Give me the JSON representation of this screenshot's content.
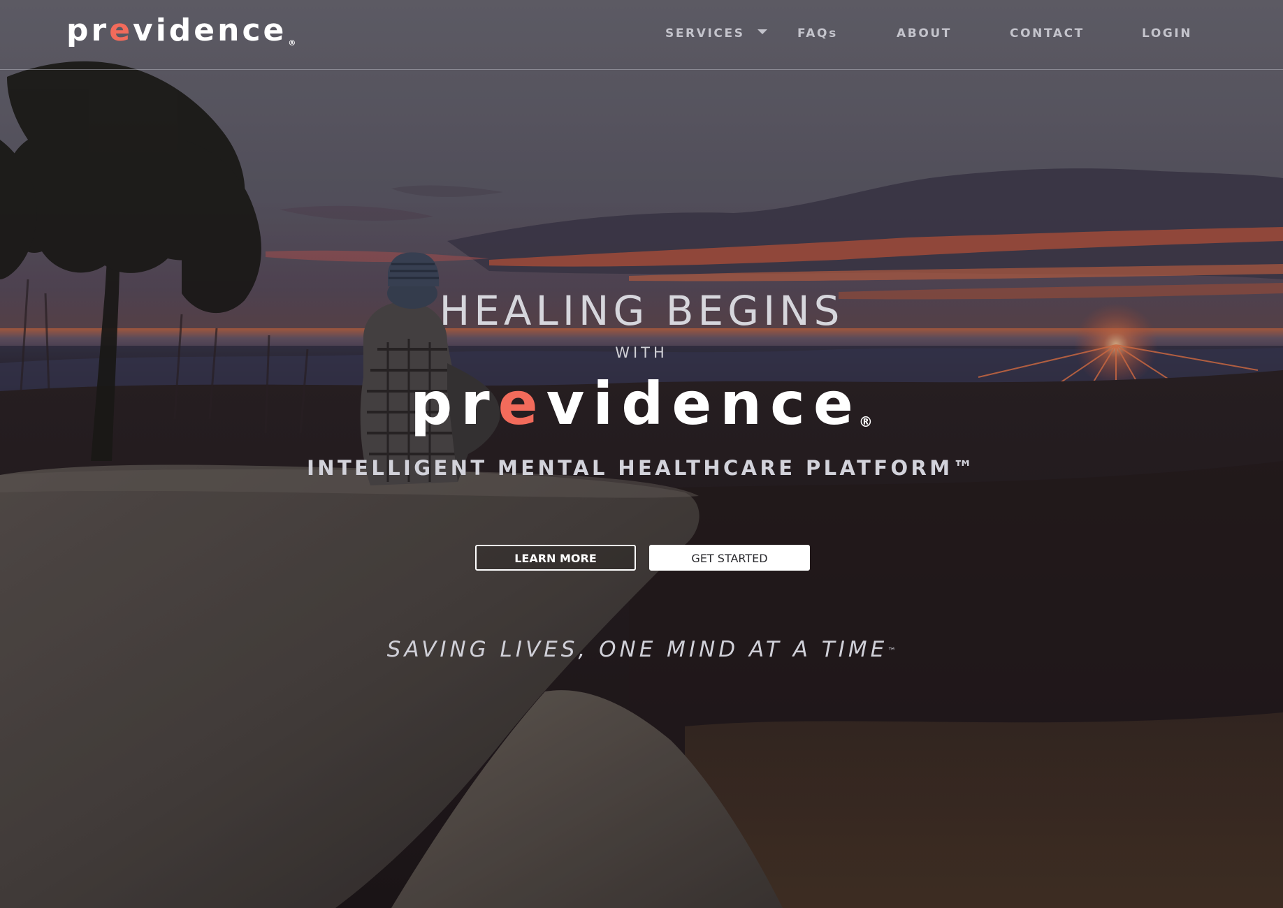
{
  "header": {
    "logo": {
      "prefix": "pr",
      "accent": "e",
      "suffix": "vidence",
      "reg": "®"
    },
    "nav": [
      {
        "label": "SERVICES",
        "has_dropdown": true
      },
      {
        "label": "FAQs",
        "has_dropdown": false
      },
      {
        "label": "ABOUT",
        "has_dropdown": false
      },
      {
        "label": "CONTACT",
        "has_dropdown": false
      },
      {
        "label": "LOGIN",
        "has_dropdown": false
      }
    ]
  },
  "hero": {
    "title": "HEALING BEGINS",
    "with": "WITH",
    "brand": {
      "prefix": "pr",
      "accent": "e",
      "suffix": "vidence",
      "reg": "®"
    },
    "subtitle": "INTELLIGENT MENTAL HEALTHCARE PLATFORM™",
    "buttons": {
      "learn_more": "LEARN MORE",
      "get_started": "GET STARTED"
    },
    "tagline": "SAVING LIVES, ONE MIND AT A TIME",
    "tagline_tm": "™"
  },
  "colors": {
    "accent": "#f26b5b",
    "text_light": "#ffffff",
    "nav_text": "#c4c4cc",
    "sky_top": "#6d6c76",
    "sunset": "#e0654a"
  },
  "icons": {
    "dropdown": "chevron-down-icon"
  }
}
